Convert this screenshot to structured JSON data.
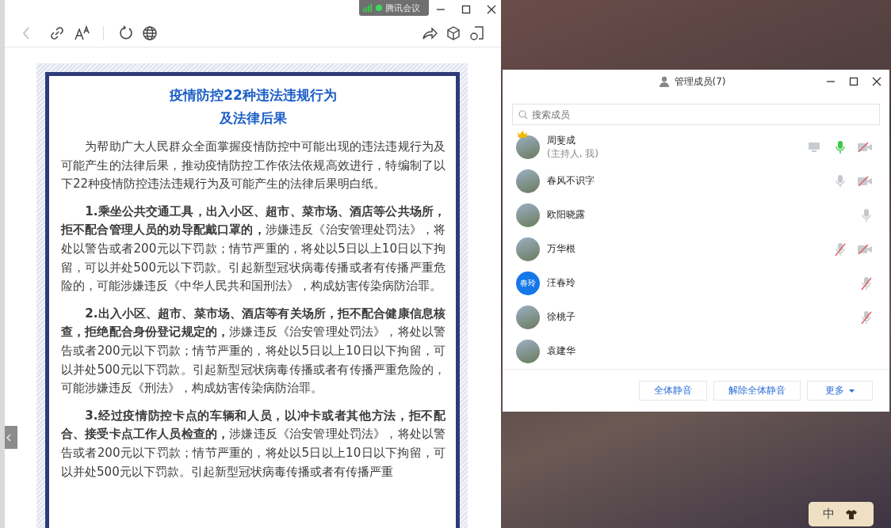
{
  "browser": {
    "badge": "腾讯会议",
    "document": {
      "title_lines": [
        "疫情防控22种违法违规行为",
        "及法律后果"
      ],
      "paragraphs": [
        "为帮助广大人民群众全面掌握疫情防控中可能出现的违法违规行为及可能产生的法律后果，推动疫情防控工作依法依规高效进行，特编制了以下22种疫情防控违法违规行为及可能产生的法律后果明白纸。",
        "**1.乘坐公共交通工具，出入小区、超市、菜市场、酒店等公共场所，拒不配合管理人员的劝导配戴口罩的，**涉嫌违反《治安管理处罚法》，将处以警告或者200元以下罚款；情节严重的，将处以5日以上10日以下拘留，可以并处500元以下罚款。引起新型冠状病毒传播或者有传播严重危险的，可能涉嫌违反《中华人民共和国刑法》，构成妨害传染病防治罪。",
        "**2.出入小区、超市、菜市场、酒店等有关场所，拒不配合健康信息核查，拒绝配合身份登记规定的，**涉嫌违反《治安管理处罚法》，将处以警告或者200元以下罚款；情节严重的，将处以5日以上10日以下拘留，可以并处500元以下罚款。引起新型冠状病毒传播或者有传播严重危险的，可能涉嫌违反《刑法》，构成妨害传染病防治罪。",
        "**3.经过疫情防控卡点的车辆和人员，以冲卡或者其他方法，拒不配合、接受卡点工作人员检查的，**涉嫌违反《治安管理处罚法》，将处以警告或者200元以下罚款；情节严重的，将处以5日以上10日以下拘留，可以并处500元以下罚款。引起新型冠状病毒传播或者有传播严重"
      ]
    }
  },
  "members_panel": {
    "title": "管理成员(7)",
    "search": {
      "placeholder": "搜索成员"
    },
    "members": [
      {
        "name": "周斐成",
        "subtitle": "(主持人, 我)",
        "kind": "photo",
        "crown": true,
        "screen": true,
        "mic": {
          "speaking": true,
          "muted": false
        },
        "camera_off": true
      },
      {
        "name": "春风不识字",
        "kind": "photo",
        "crown": false,
        "screen": false,
        "mic": {
          "speaking": false,
          "muted": false
        },
        "camera_off": true
      },
      {
        "name": "欧阳晓露",
        "kind": "photo",
        "crown": false,
        "screen": false,
        "mic": {
          "speaking": false,
          "muted": false
        },
        "camera_off": false
      },
      {
        "name": "万华根",
        "kind": "photo",
        "crown": false,
        "screen": false,
        "mic": {
          "speaking": false,
          "muted": true
        },
        "camera_off": true
      },
      {
        "name": "汪春玲",
        "kind": "initials",
        "initials": "春玲",
        "crown": false,
        "screen": false,
        "mic": {
          "speaking": false,
          "muted": true
        },
        "camera_off": false
      },
      {
        "name": "徐桃子",
        "kind": "photo",
        "crown": false,
        "screen": false,
        "mic": {
          "speaking": false,
          "muted": true
        },
        "camera_off": false
      },
      {
        "name": "袁建华",
        "kind": "photo",
        "crown": false,
        "screen": false,
        "camera_off": false
      }
    ],
    "buttons": [
      "全体静音",
      "解除全体静音"
    ],
    "more_button": "更多"
  },
  "ime": {
    "label": "中"
  }
}
